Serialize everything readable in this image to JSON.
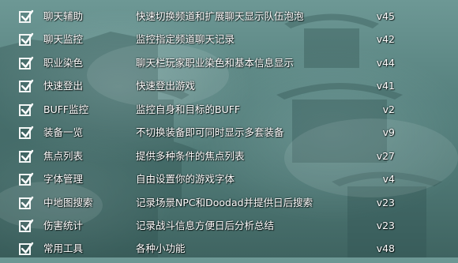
{
  "addons": [
    {
      "name": "聊天辅助",
      "description": "快速切换频道和扩展聊天显示队伍泡泡",
      "version": "v45",
      "enabled": true
    },
    {
      "name": "聊天监控",
      "description": "监控指定频道聊天记录",
      "version": "v42",
      "enabled": true
    },
    {
      "name": "职业染色",
      "description": "聊天栏玩家职业染色和基本信息显示",
      "version": "v44",
      "enabled": true
    },
    {
      "name": "快速登出",
      "description": "快速登出游戏",
      "version": "v41",
      "enabled": true
    },
    {
      "name": "BUFF监控",
      "description": "监控自身和目标的BUFF",
      "version": "v2",
      "enabled": true
    },
    {
      "name": "装备一览",
      "description": "不切换装备即可同时显示多套装备",
      "version": "v9",
      "enabled": true
    },
    {
      "name": "焦点列表",
      "description": "提供多种条件的焦点列表",
      "version": "v27",
      "enabled": true
    },
    {
      "name": "字体管理",
      "description": "自由设置你的游戏字体",
      "version": "v4",
      "enabled": true
    },
    {
      "name": "中地图搜索",
      "description": "记录场景NPC和Doodad并提供日后搜索",
      "version": "v23",
      "enabled": true
    },
    {
      "name": "伤害统计",
      "description": "记录战斗信息方便日后分析总结",
      "version": "v23",
      "enabled": true
    },
    {
      "name": "常用工具",
      "description": "各种小功能",
      "version": "v48",
      "enabled": true
    }
  ]
}
